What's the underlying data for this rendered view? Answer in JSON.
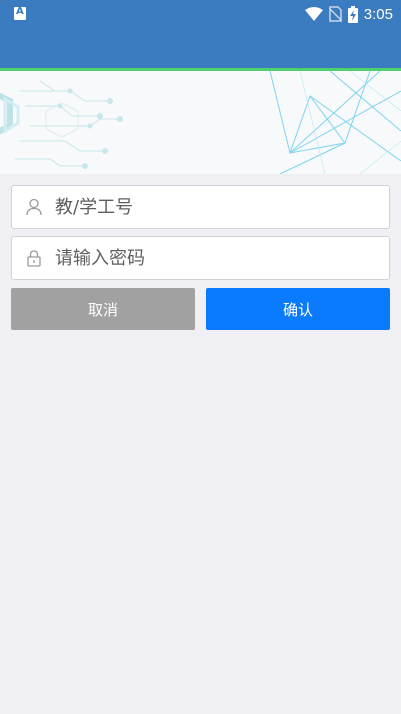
{
  "status_bar": {
    "time": "3:05",
    "app_icon": "app-a-icon",
    "icons": [
      "wifi-icon",
      "no-sim-icon",
      "battery-charging-icon"
    ]
  },
  "login": {
    "username_placeholder": "教/学工号",
    "username_value": "",
    "username_icon": "user-icon",
    "password_placeholder": "请输入密码",
    "password_value": "",
    "password_icon": "lock-icon",
    "cancel_label": "取消",
    "confirm_label": "确认"
  },
  "colors": {
    "header": "#3b7bbf",
    "accent_line": "#4fd06a",
    "page_bg": "#efeff4",
    "cancel_button": "#a1a1a1",
    "confirm_button": "#0a7bff"
  }
}
